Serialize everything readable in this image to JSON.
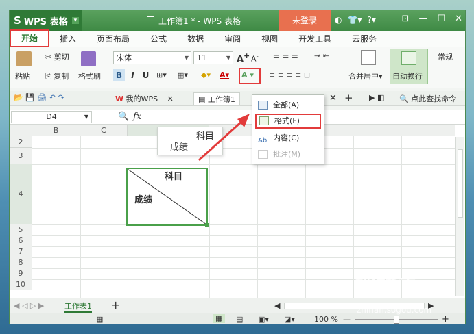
{
  "window": {
    "app_name": "WPS 表格",
    "doc_title": "工作簿1 * - WPS 表格",
    "login_label": "未登录",
    "help_label": "?"
  },
  "menu_tabs": [
    "开始",
    "插入",
    "页面布局",
    "公式",
    "数据",
    "审阅",
    "视图",
    "开发工具",
    "云服务"
  ],
  "ribbon": {
    "paste": "粘贴",
    "cut": "剪切",
    "copy": "复制",
    "format_painter": "格式刷",
    "font_name": "宋体",
    "font_size": "11",
    "bold": "B",
    "italic": "I",
    "underline": "U",
    "merge_center": "合并居中",
    "wrap_text": "自动换行",
    "number_format": "常规"
  },
  "quickbar": {
    "tab_mywps": "我的WPS",
    "tab_workbook": "工作簿1",
    "search_label": "点此查找命令"
  },
  "formula_bar": {
    "name_box": "D4",
    "fx": "fx"
  },
  "columns": [
    "B",
    "C"
  ],
  "rows": [
    "2",
    "3",
    "4",
    "5",
    "6",
    "7",
    "8",
    "9",
    "10"
  ],
  "cell_d4": {
    "top_text": "科目",
    "bottom_text": "成绩"
  },
  "popup_preview": {
    "top_text": "科目",
    "bottom_text": "成绩"
  },
  "clear_menu": {
    "items": [
      "全部(A)",
      "格式(F)",
      "内容(C)",
      "批注(M)"
    ]
  },
  "sheet_tab": "工作表1",
  "status": {
    "zoom": "100 %"
  },
  "watermark": {
    "text": "搜狗指南",
    "url": "zhinan.sogou.com"
  }
}
